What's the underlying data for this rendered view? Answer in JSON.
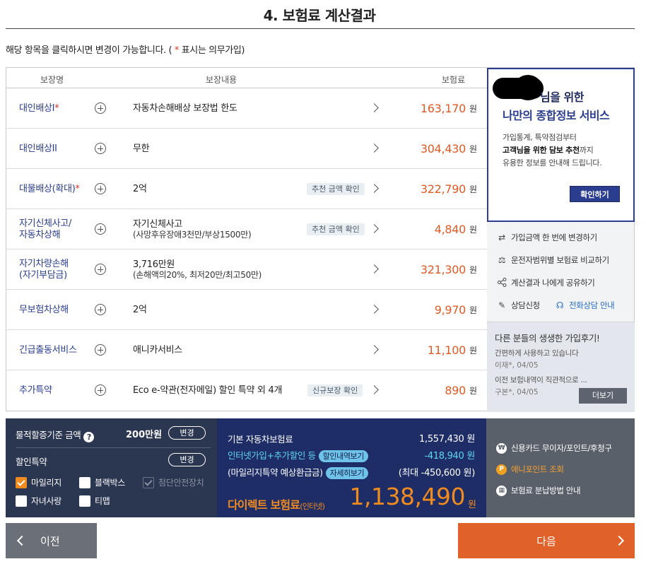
{
  "title": "4. 보험료 계산결과",
  "notice": {
    "pre": "해당 항목을 클릭하시면 변경이 가능합니다. ( ",
    "star": "*",
    "post": " 표시는 의무가입)"
  },
  "table": {
    "headers": {
      "name": "보장명",
      "content": "보장내용",
      "premium": "보험료"
    },
    "rows": [
      {
        "name": "대인배상I",
        "req": "*",
        "desc": "자동차손해배상 보장법 한도",
        "sub": "",
        "tag": "",
        "amount": "163,170",
        "unit": "원"
      },
      {
        "name": "대인배상II",
        "req": "",
        "desc": "무한",
        "sub": "",
        "tag": "",
        "amount": "304,430",
        "unit": "원"
      },
      {
        "name": "대물배상(확대)",
        "req": "*",
        "desc": "2억",
        "sub": "",
        "tag": "추천 금액 확인",
        "amount": "322,790",
        "unit": "원"
      },
      {
        "name": "자기신체사고/\n자동차상해",
        "req": "",
        "desc": "자기신체사고",
        "sub": "(사망후유장애3천만/부상1500만)",
        "tag": "추천 금액 확인",
        "amount": "4,840",
        "unit": "원"
      },
      {
        "name": "자기차량손해\n(자기부담금)",
        "req": "",
        "desc": "3,716만원",
        "sub": "(손해액의20%, 최저20만/최고50만)",
        "tag": "",
        "amount": "321,300",
        "unit": "원"
      },
      {
        "name": "무보험차상해",
        "req": "",
        "desc": "2억",
        "sub": "",
        "tag": "",
        "amount": "9,970",
        "unit": "원"
      },
      {
        "name": "긴급출동서비스",
        "req": "",
        "desc": "애니카서비스",
        "sub": "",
        "tag": "",
        "amount": "11,100",
        "unit": "원"
      },
      {
        "name": "추가특약",
        "req": "",
        "desc": "Eco e-약관(전자메일) 할인 특약 외 4개",
        "sub": "",
        "tag": "신규보장 확인",
        "amount": "890",
        "unit": "원"
      }
    ]
  },
  "promo": {
    "line1": "님을 위한",
    "line2": "나만의 종합정보 서비스",
    "desc1": "가입통계, 특약점검부터",
    "desc2_bold": "고객님을 위한 담보 추천",
    "desc2_rest": "까지",
    "desc3": "유용한 정보를 안내해 드립니다.",
    "button": "확인하기"
  },
  "side_menu": {
    "change_all": "가입금액 한 번에 변경하기",
    "compare": "운전자범위별 보험료 비교하기",
    "share": "계산결과 나에게 공유하기",
    "consult": "상담신청",
    "phone": "전화상담 안내"
  },
  "reviews": {
    "heading": "다른 분들의 생생한 가입후기!",
    "items": [
      {
        "text": "간편하게 사용하고 있습니다",
        "author": "이재*, 04/05"
      },
      {
        "text": "이전 보험내역이 직관적으로 ...",
        "author": "구본*, 04/05"
      }
    ],
    "more": "더보기"
  },
  "bottom": {
    "property_label": "물적할증기준 금액",
    "property_value": "200만원",
    "change": "변경",
    "discount_label": "할인특약",
    "checkboxes": [
      {
        "label": "마일리지",
        "state": "checked"
      },
      {
        "label": "블랙박스",
        "state": "unchecked"
      },
      {
        "label": "첨단안전장치",
        "state": "disabled"
      },
      {
        "label": "자녀사랑",
        "state": "unchecked"
      },
      {
        "label": "티맵",
        "state": "unchecked"
      }
    ],
    "base_label": "기본 자동차보험료",
    "base_value": "1,557,430 원",
    "internet_label": "인터넷가입+추가할인 등",
    "internet_chip": "할인내역보기",
    "internet_value": "-418,940 원",
    "mileage_label": "(마일리지특약 예상환급금)",
    "mileage_chip": "자세히보기",
    "mileage_value": "(최대 -450,600 원)",
    "direct_label": "다이렉트 보험료",
    "direct_small": "(인터넷)",
    "total": "1,138,490",
    "total_unit": "원"
  },
  "pay": {
    "card": "신용카드 무이자/포인트/후청구",
    "point": "애니포인트 조회",
    "installment": "보험료 분납방법 안내"
  },
  "nav": {
    "prev": "이전",
    "next": "다음"
  },
  "colors": {
    "accent": "#e0622a",
    "navy": "#2a3d8f",
    "amount": "#e05a25"
  }
}
